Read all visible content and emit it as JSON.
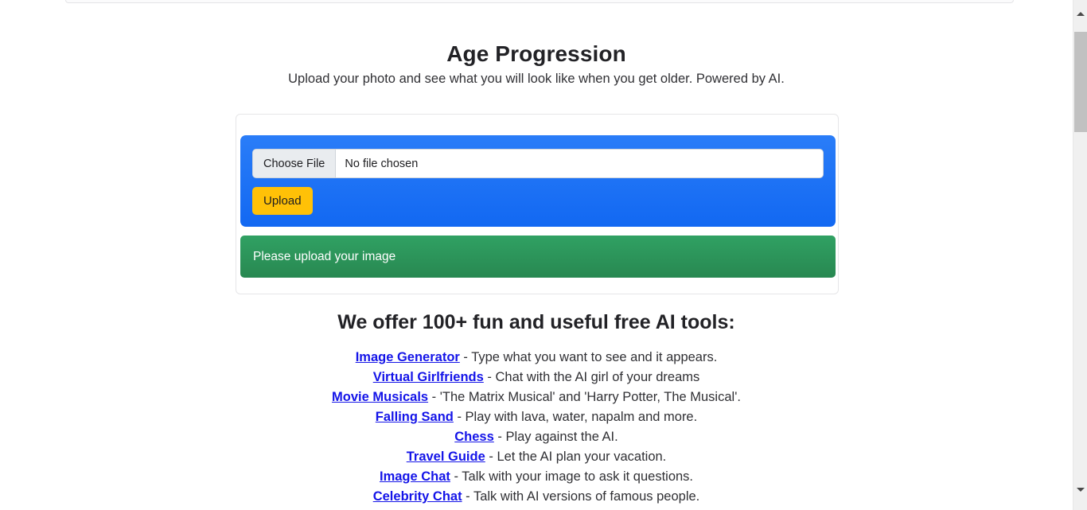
{
  "header": {
    "title": "Age Progression",
    "subtitle": "Upload your photo and see what you will look like when you get older. Powered by AI."
  },
  "upload_form": {
    "choose_file_label": "Choose File",
    "file_name_value": "No file chosen",
    "upload_button_label": "Upload",
    "form_background_color": "#1773f7",
    "upload_button_color": "#ffc107"
  },
  "status": {
    "message": "Please upload your image",
    "color": "#2e9159"
  },
  "tools": {
    "heading": "We offer 100+ fun and useful free AI tools:",
    "items": [
      {
        "link": "Image Generator",
        "desc": " - Type what you want to see and it appears."
      },
      {
        "link": "Virtual Girlfriends",
        "desc": " - Chat with the AI girl of your dreams"
      },
      {
        "link": "Movie Musicals",
        "desc": " - 'The Matrix Musical' and 'Harry Potter, The Musical'."
      },
      {
        "link": "Falling Sand",
        "desc": " - Play with lava, water, napalm and more."
      },
      {
        "link": "Chess",
        "desc": " - Play against the AI."
      },
      {
        "link": "Travel Guide",
        "desc": " - Let the AI plan your vacation."
      },
      {
        "link": "Image Chat",
        "desc": " - Talk with your image to ask it questions."
      },
      {
        "link": "Celebrity Chat",
        "desc": " - Talk with AI versions of famous people."
      }
    ],
    "link_color": "#1414e8"
  },
  "scrollbar": {
    "up_arrow_icon": "chevron-up-icon",
    "down_arrow_icon": "chevron-down-icon"
  }
}
